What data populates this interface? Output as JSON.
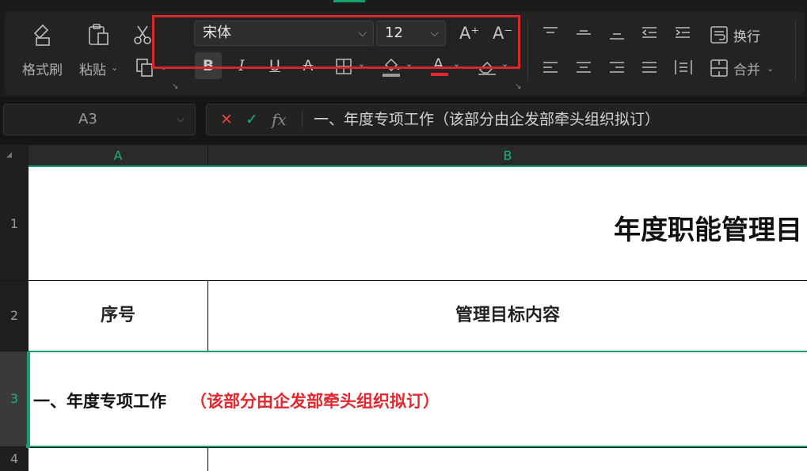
{
  "ribbon": {
    "clipboard": {
      "format_painter_label": "格式刷",
      "paste_label": "粘贴"
    },
    "font": {
      "family": "宋体",
      "size": "12",
      "increase_glyph": "A⁺",
      "decrease_glyph": "A⁻",
      "bold_glyph": "B",
      "italic_glyph": "I",
      "underline_glyph": "U",
      "strike_glyph": "A",
      "font_color_glyph": "A",
      "font_color": "#e5282f",
      "fill_color": "#9a9a9a"
    },
    "alignment": {
      "wrap_label": "换行",
      "merge_label": "合并"
    }
  },
  "formula_bar": {
    "cell_ref": "A3",
    "cancel_glyph": "✕",
    "confirm_glyph": "✓",
    "fx_glyph": "fx",
    "content": "一、年度专项工作（该部分由企发部牵头组织拟订）"
  },
  "grid": {
    "columns": [
      "A",
      "B"
    ],
    "rows": [
      "1",
      "2",
      "3",
      "4"
    ],
    "title": "年度职能管理目",
    "header_seq": "序号",
    "header_content": "管理目标内容",
    "row3_black": "一、年度专项工作",
    "row3_red": "（该部分由企发部牵头组织拟订）",
    "accent_color": "#1aa06a",
    "red_text_color": "#e5282f"
  }
}
